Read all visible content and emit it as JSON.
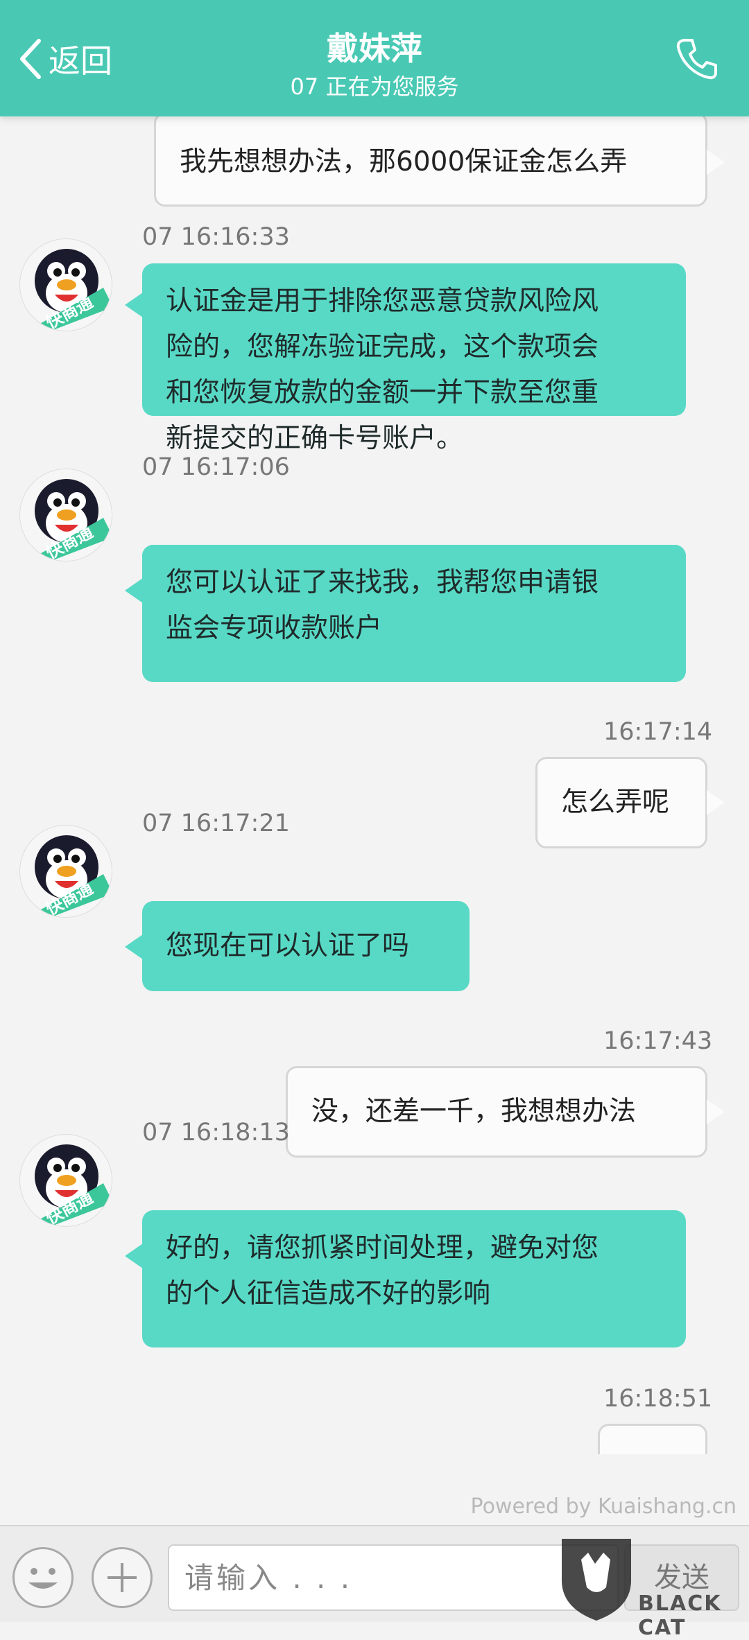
{
  "header": {
    "back_label": "返回",
    "title": "戴妹萍",
    "subtitle": "07 正在为您服务"
  },
  "messages": [
    {
      "side": "right",
      "text": "我先想想办法，那6000保证金怎么弄"
    },
    {
      "side": "left",
      "time": "07  16:16:33",
      "text_lines": [
        "认证金是用于排除您恶意贷款风险风",
        "险的，您解冻验证完成，这个款项会",
        "和您恢复放款的金额一并下款至您重",
        "新提交的正确卡号账户。"
      ]
    },
    {
      "side": "left",
      "time": "07  16:17:06",
      "text_lines": [
        "您可以认证了来找我，我帮您申请银",
        "监会专项收款账户"
      ]
    },
    {
      "side": "right",
      "time": "16:17:14",
      "text": "怎么弄呢"
    },
    {
      "side": "left",
      "time": "07  16:17:21",
      "text": "您现在可以认证了吗"
    },
    {
      "side": "right",
      "time": "16:17:43",
      "text": "没，还差一千，我想想办法"
    },
    {
      "side": "left",
      "time": "07  16:18:13",
      "text_lines": [
        "好的，请您抓紧时间处理，避免对您",
        "的个人征信造成不好的影响"
      ]
    },
    {
      "side": "right",
      "time": "16:18:51",
      "text": ""
    }
  ],
  "avatar_badge": "快商通",
  "powered_by": "Powered by Kuaishang.cn",
  "input": {
    "placeholder": "请输入 . . .",
    "send_label": "发送"
  },
  "watermark": "BLACK CAT",
  "colors": {
    "header": "#49c9b4",
    "agent_bubble": "#58d9c6",
    "user_bubble": "#fbfbfb"
  }
}
